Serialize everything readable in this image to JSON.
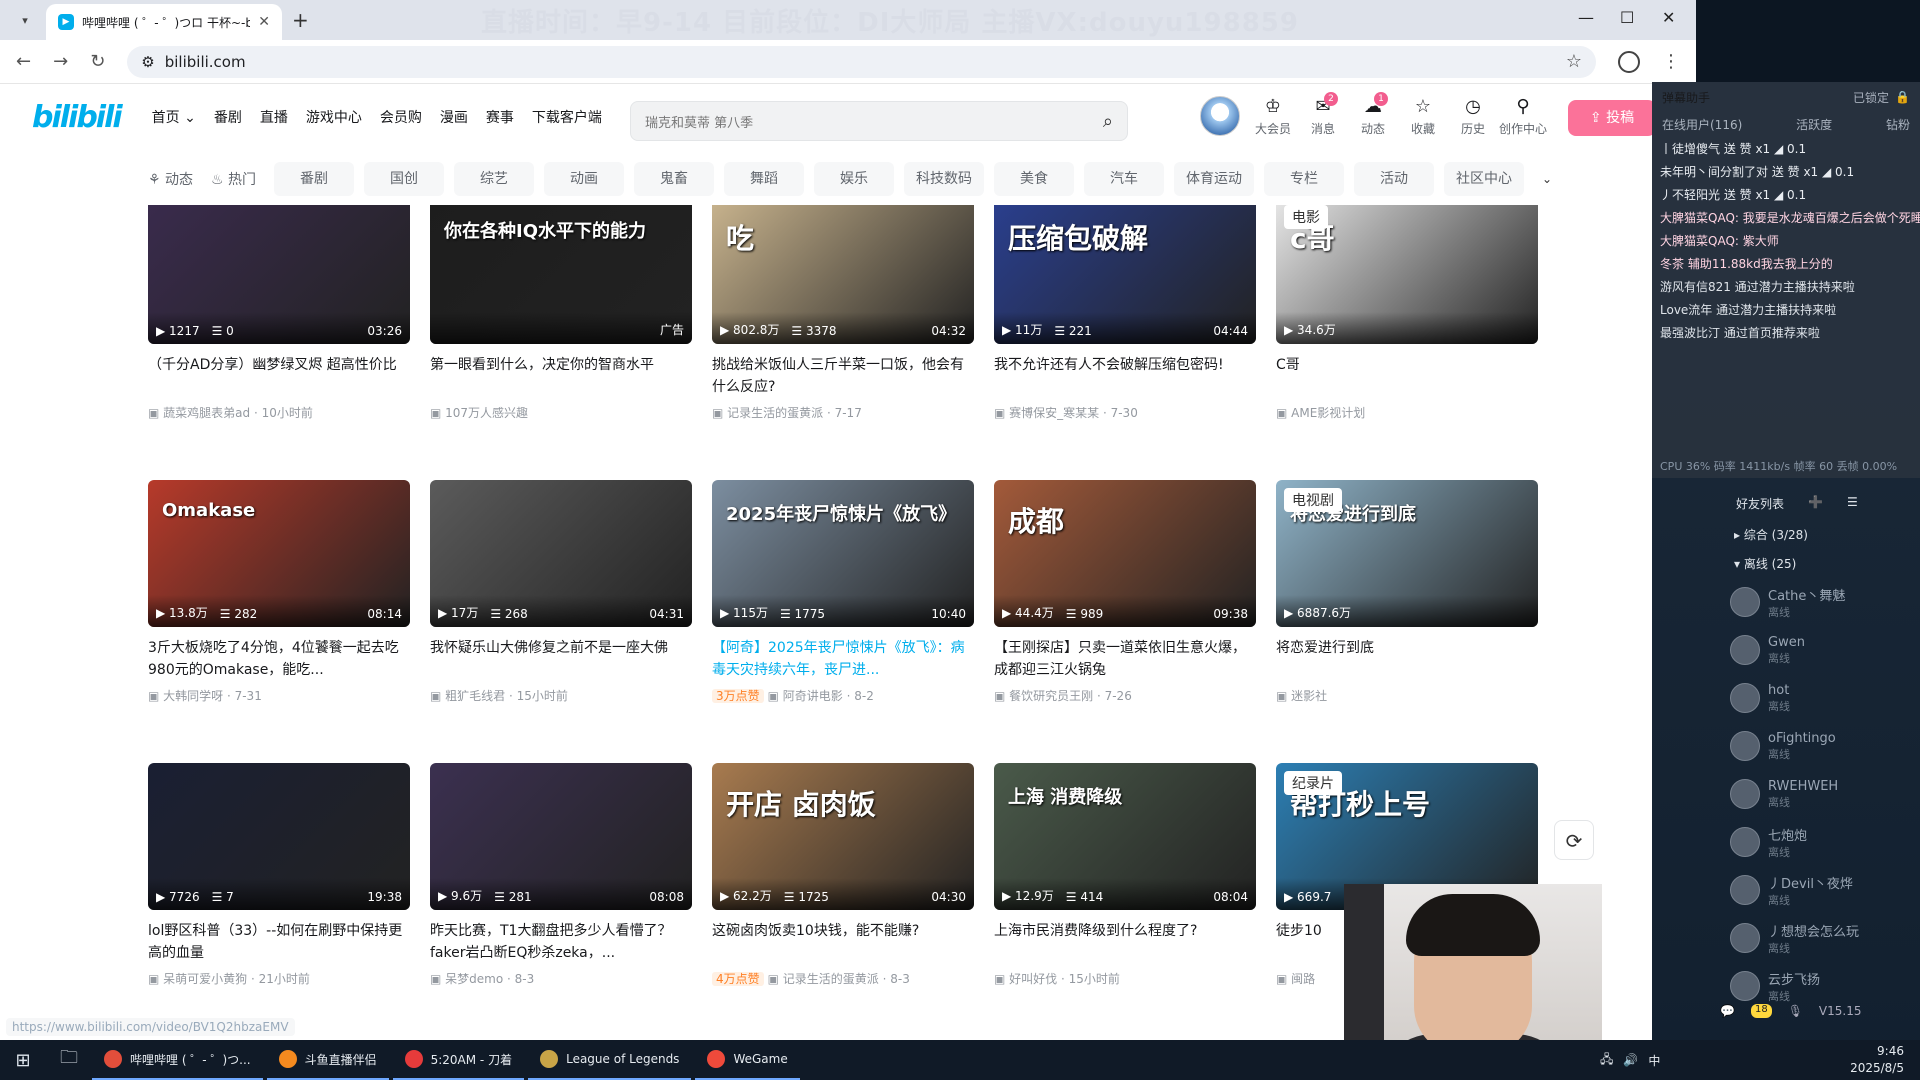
{
  "banner": "直播时间：早9-14 目前段位：DI大师局 主播VX:douyu198859",
  "browser": {
    "tab_title": "哔哩哔哩 ( ゜- ゜)つロ 干杯~-bi",
    "url": "bilibili.com"
  },
  "bili": {
    "logo": "bilibili",
    "nav": [
      "首页 ⌄",
      "番剧",
      "直播",
      "游戏中心",
      "会员购",
      "漫画",
      "赛事",
      "下载客户端"
    ],
    "search_placeholder": "瑞克和莫蒂 第八季",
    "user_icons": [
      {
        "label": "大会员",
        "badge": ""
      },
      {
        "label": "消息",
        "badge": "2"
      },
      {
        "label": "动态",
        "badge": "1"
      },
      {
        "label": "收藏",
        "badge": ""
      },
      {
        "label": "历史",
        "badge": ""
      },
      {
        "label": "创作中心",
        "badge": ""
      }
    ],
    "upload": "投稿",
    "channels_left": [
      "动态",
      "热门"
    ],
    "channels": [
      "番剧",
      "国创",
      "综艺",
      "动画",
      "鬼畜",
      "舞蹈",
      "娱乐",
      "科技数码",
      "美食",
      "汽车",
      "体育运动",
      "专栏",
      "活动",
      "社区中心"
    ],
    "status_url": "https://www.bilibili.com/video/BV1Q2hbzaEMV"
  },
  "videos": [
    {
      "title": "（千分AD分享）幽梦绿叉烬 超高性价比",
      "views": "1217",
      "danmaku": "0",
      "duration": "03:26",
      "meta": "蔬菜鸡腿表弟ad · 10小时前",
      "tag": "",
      "thumb_text": "",
      "pill": ""
    },
    {
      "title": "第一眼看到什么，决定你的智商水平",
      "views": "",
      "danmaku": "",
      "duration": "广告",
      "meta": "107万人感兴趣",
      "tag": "",
      "thumb_text": "你在各种IQ水平下的能力",
      "pill": ""
    },
    {
      "title": "挑战给米饭仙人三斤半菜一口饭，他会有什么反应?",
      "views": "802.8万",
      "danmaku": "3378",
      "duration": "04:32",
      "meta": "记录生活的蛋黄派 · 7-17",
      "tag": "",
      "thumb_text": "吃",
      "pill": ""
    },
    {
      "title": "我不允许还有人不会破解压缩包密码!",
      "views": "11万",
      "danmaku": "221",
      "duration": "04:44",
      "meta": "赛博保安_寒某某 · 7-30",
      "tag": "",
      "thumb_text": "压缩包破解",
      "pill": ""
    },
    {
      "title": "C哥",
      "views": "34.6万",
      "danmaku": "",
      "duration": "",
      "meta": "AME影视计划",
      "tag": "电影",
      "thumb_text": "c哥",
      "pill": ""
    },
    {
      "title": "3斤大板烧吃了4分饱，4位饕餮一起去吃980元的Omakase，能吃...",
      "views": "13.8万",
      "danmaku": "282",
      "duration": "08:14",
      "meta": "大韩同学呀 · 7-31",
      "tag": "",
      "thumb_text": "Omakase",
      "pill": ""
    },
    {
      "title": "我怀疑乐山大佛修复之前不是一座大佛",
      "views": "17万",
      "danmaku": "268",
      "duration": "04:31",
      "meta": "粗犷毛线君 · 15小时前",
      "tag": "",
      "thumb_text": "",
      "pill": ""
    },
    {
      "title": "【阿奇】2025年丧尸惊悚片《放飞》：病毒天灾持续六年，丧尸进...",
      "views": "115万",
      "danmaku": "1775",
      "duration": "10:40",
      "meta": "阿奇讲电影 · 8-2",
      "tag": "",
      "thumb_text": "2025年丧尸惊悚片《放飞》",
      "pill": "3万点赞"
    },
    {
      "title": "【王刚探店】只卖一道菜依旧生意火爆，成都迎三江火锅兔",
      "views": "44.4万",
      "danmaku": "989",
      "duration": "09:38",
      "meta": "餐饮研究员王刚 · 7-26",
      "tag": "",
      "thumb_text": "成都",
      "pill": ""
    },
    {
      "title": "将恋爱进行到底",
      "views": "6887.6万",
      "danmaku": "",
      "duration": "",
      "meta": "迷影社",
      "tag": "电视剧",
      "thumb_text": "将恋爱进行到底",
      "pill": ""
    },
    {
      "title": "lol野区科普（33）--如何在刷野中保持更高的血量",
      "views": "7726",
      "danmaku": "7",
      "duration": "19:38",
      "meta": "呆萌可爱小黄狗 · 21小时前",
      "tag": "",
      "thumb_text": "",
      "pill": ""
    },
    {
      "title": "昨天比赛，T1大翻盘把多少人看懵了？faker岩凸断EQ秒杀zeka，...",
      "views": "9.6万",
      "danmaku": "281",
      "duration": "08:08",
      "meta": "呆梦demo · 8-3",
      "tag": "",
      "thumb_text": "",
      "pill": ""
    },
    {
      "title": "这碗卤肉饭卖10块钱，能不能赚?",
      "views": "62.2万",
      "danmaku": "1725",
      "duration": "04:30",
      "meta": "记录生活的蛋黄派 · 8-3",
      "tag": "",
      "thumb_text": "开店 卤肉饭",
      "pill": "4万点赞"
    },
    {
      "title": "上海市民消费降级到什么程度了?",
      "views": "12.9万",
      "danmaku": "414",
      "duration": "08:04",
      "meta": "好叫好伐 · 15小时前",
      "tag": "",
      "thumb_text": "上海 消费降级",
      "pill": ""
    },
    {
      "title": "徒步10",
      "views": "669.7",
      "danmaku": "",
      "duration": "",
      "meta": "闽路",
      "tag": "纪录片",
      "thumb_text": "帮打秒上号",
      "pill": ""
    }
  ],
  "thumb_colors": [
    "#3a2b4d",
    "#1d1d1d",
    "#c9b48e",
    "#2a3f8f",
    "#e8e8e8",
    "#b73a2a",
    "#5b5b5b",
    "#7c8ea0",
    "#a35a3a",
    "#8fb3c8",
    "#1a1f33",
    "#3b3050",
    "#a87b4f",
    "#4a5a4a",
    "#2c7fb4"
  ],
  "stream_panel": {
    "title": "弹幕助手",
    "locked": "已锁定",
    "tabs": [
      "在线用户(116)",
      "活跃度",
      "钻粉"
    ],
    "cpu": "CPU 36% 码率 1411kb/s 帧率 60 丢帧 0.00%",
    "danmaku": [
      {
        "text": "丨徒增傻气 送 赞 x1 ◢ 0.1",
        "style": "gift"
      },
      {
        "text": "未年明丶间分割了对 送 赞 x1 ◢ 0.1",
        "style": "gift"
      },
      {
        "text": "丿不轻阳光 送 赞 x1 ◢ 0.1",
        "style": "gift"
      },
      {
        "text": "大脾猫菜QAQ: 我要是水龙魂百爆之后会做个死睡 有奇效",
        "style": "pink"
      },
      {
        "text": "大脾猫菜QAQ: 紫大师",
        "style": "pink"
      },
      {
        "text": "冬茶 辅助11.88kd我去我上分的",
        "style": "pink"
      },
      {
        "text": "游风有信821 通过潜力主播扶持来啦",
        "style": "norm"
      },
      {
        "text": "Love流年 通过潜力主播扶持来啦",
        "style": "norm"
      },
      {
        "text": "最强波比汀 通过首页推荐来啦",
        "style": "norm"
      }
    ],
    "friends_title": "好友列表",
    "groups": [
      "综合 (3/28)",
      "离线 (25)"
    ],
    "friends": [
      {
        "name": "Cathe丶舞魅",
        "status": "离线"
      },
      {
        "name": "Gwen",
        "status": "离线"
      },
      {
        "name": "hot",
        "status": "离线"
      },
      {
        "name": "oFightingo",
        "status": "离线"
      },
      {
        "name": "RWEHWEH",
        "status": "离线"
      },
      {
        "name": "七炮炮",
        "status": "离线"
      },
      {
        "name": "丿Devil丶夜烨",
        "status": "离线"
      },
      {
        "name": "丿想想会怎么玩",
        "status": "离线"
      },
      {
        "name": "云步飞扬",
        "status": "离线"
      }
    ],
    "friends_badge": "18",
    "version": "V15.15"
  },
  "taskbar": {
    "items": [
      "哔哩哔哩 ( ゜- ゜)つ...",
      "斗鱼直播伴侣",
      "5:20AM - 刀着",
      "League of Legends",
      "WeGame"
    ],
    "item_colors": [
      "#e24e3b",
      "#f58a1f",
      "#e63b3b",
      "#c8a447",
      "#ef4a3b"
    ],
    "time": "9:46",
    "date": "2025/8/5",
    "ime": "中"
  }
}
